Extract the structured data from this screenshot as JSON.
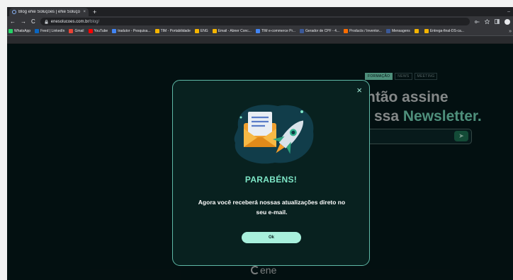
{
  "browser": {
    "tab_title": "Blog eNe Soluções | eNe Soluçõ",
    "tab_close": "×",
    "new_tab": "+",
    "window_controls": "–",
    "nav": {
      "back": "←",
      "forward": "→",
      "reload": "C"
    },
    "url_host": "enesolucoes.com.br",
    "url_path": "/blog/",
    "bookmarks": [
      {
        "label": "WhatsApp",
        "color": "#25d366"
      },
      {
        "label": "Feed | LinkedIn",
        "color": "#0a66c2"
      },
      {
        "label": "Gmail",
        "color": "#ea4335"
      },
      {
        "label": "YouTube",
        "color": "#ff0000"
      },
      {
        "label": "tradutor - Pesquisa...",
        "color": "#4285f4"
      },
      {
        "label": "TIM - Portabilidade",
        "color": "#f4b400"
      },
      {
        "label": "ENG",
        "color": "#f4b400"
      },
      {
        "label": "Email - Abner Conc...",
        "color": "#f4b400"
      },
      {
        "label": "TIM e-commerce Pr...",
        "color": "#4285f4"
      },
      {
        "label": "Gerador de CPF - 4...",
        "color": "#3b5998"
      },
      {
        "label": "Products / Inventor...",
        "color": "#ff6d00"
      },
      {
        "label": "Mensagens",
        "color": "#3b5998"
      },
      {
        "label": "",
        "color": "#f4b400"
      },
      {
        "label": "Entrega-final-DS-ca...",
        "color": "#f4b400"
      }
    ],
    "bookmarks_more": "»"
  },
  "page": {
    "tags": [
      "FORMAÇÃO",
      "NEWS",
      "MEETING"
    ],
    "hero_line1": "stou? Então assine",
    "hero_line2_plain": "ssa ",
    "hero_line2_accent": "Newsletter.",
    "send_icon": "➤",
    "logo_text": "ene"
  },
  "modal": {
    "close_label": "×",
    "title": "PARABÉNS!",
    "message": "Agora você receberá nossas atualizações direto no seu e-mail.",
    "ok_label": "Ok",
    "icons": [
      "envelope-icon",
      "rocket-icon"
    ]
  },
  "colors": {
    "accent": "#7ee7c7",
    "modal_bg": "#08211f",
    "modal_border": "#5fb9a7",
    "page_bg": "#061a1c",
    "button_bg": "#a8f0dc"
  }
}
